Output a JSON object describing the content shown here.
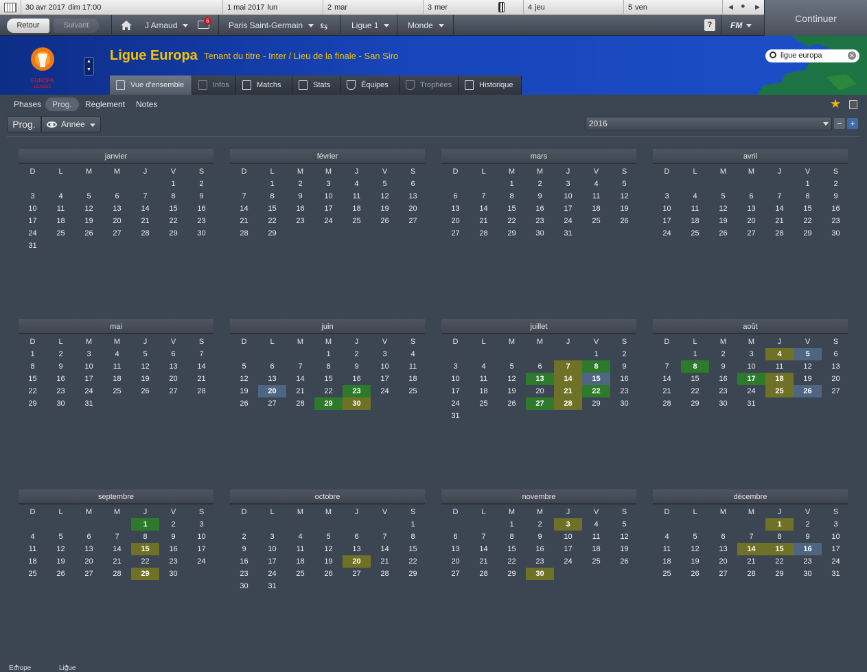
{
  "topbar": {
    "current": "30 avr 2017",
    "current_day": "dim 17:00",
    "days": [
      {
        "date": "1 mai 2017",
        "weekday": "lun"
      },
      {
        "date": "2",
        "weekday": "mar"
      },
      {
        "date": "3",
        "weekday": "mer"
      },
      {
        "date": "4",
        "weekday": "jeu"
      },
      {
        "date": "5",
        "weekday": "ven"
      }
    ]
  },
  "nav": {
    "back": "Retour",
    "next": "Suivant",
    "manager": "J Arnaud",
    "inbox_count": "6",
    "club": "Paris Saint-Germain",
    "competition": "Ligue 1",
    "world": "Monde",
    "help": "?",
    "fm": "FM"
  },
  "continue_label": "Continuer",
  "header": {
    "title": "Ligue Europa",
    "subtitle": "Tenant du titre - Inter / Lieu de la finale - San Siro",
    "logo_text_1": "EUROPA",
    "logo_text_2": "LEAGUE",
    "search_value": "ligue europa"
  },
  "tabs": [
    "Vue d'ensemble",
    "Infos",
    "Matchs",
    "Stats",
    "Équipes",
    "Trophées",
    "Historique"
  ],
  "subnav": [
    "Phases",
    "Prog.",
    "Règlement",
    "Notes"
  ],
  "toolbar": {
    "prog": "Prog.",
    "view": "Année",
    "year": "2016"
  },
  "calendar": {
    "weekday_headers": [
      "D",
      "L",
      "M",
      "M",
      "J",
      "V",
      "S"
    ],
    "legend_colors": {
      "green": "#2e7a2d",
      "olive": "#6f7226",
      "blue": "#4e6682"
    },
    "months": [
      {
        "name": "janvier",
        "offset": 5,
        "days": 31,
        "marks": {}
      },
      {
        "name": "février",
        "offset": 1,
        "days": 29,
        "marks": {}
      },
      {
        "name": "mars",
        "offset": 2,
        "days": 31,
        "marks": {}
      },
      {
        "name": "avril",
        "offset": 5,
        "days": 30,
        "marks": {}
      },
      {
        "name": "mai",
        "offset": 0,
        "days": 31,
        "marks": {}
      },
      {
        "name": "juin",
        "offset": 3,
        "days": 30,
        "marks": {
          "20": "b",
          "23": "g",
          "29": "g",
          "30": "o"
        }
      },
      {
        "name": "juillet",
        "offset": 5,
        "days": 31,
        "marks": {
          "7": "o",
          "8": "g",
          "13": "g",
          "14": "o",
          "15": "b",
          "21": "o",
          "22": "g",
          "27": "g",
          "28": "o"
        }
      },
      {
        "name": "août",
        "offset": 1,
        "days": 31,
        "marks": {
          "4": "o",
          "5": "b",
          "8": "g",
          "17": "g",
          "18": "o",
          "25": "o",
          "26": "b"
        }
      },
      {
        "name": "septembre",
        "offset": 4,
        "days": 30,
        "marks": {
          "1": "g",
          "15": "o",
          "29": "o"
        }
      },
      {
        "name": "octobre",
        "offset": 6,
        "days": 31,
        "marks": {
          "20": "o"
        }
      },
      {
        "name": "novembre",
        "offset": 2,
        "days": 30,
        "marks": {
          "3": "o",
          "30": "o"
        }
      },
      {
        "name": "décembre",
        "offset": 4,
        "days": 31,
        "marks": {
          "1": "o",
          "14": "o",
          "15": "o",
          "16": "b"
        }
      }
    ]
  },
  "bottom": [
    "Europe",
    "Ligue Europa"
  ]
}
